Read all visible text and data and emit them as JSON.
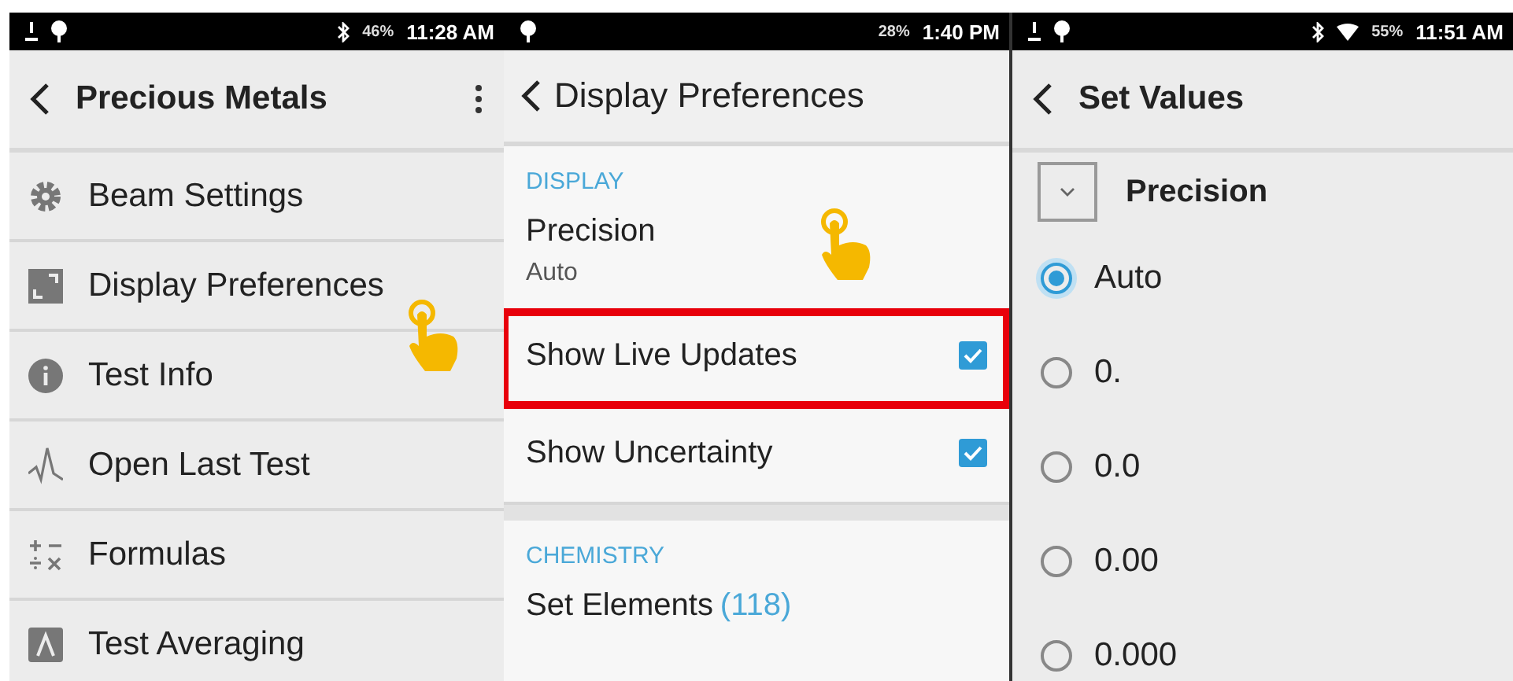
{
  "screens": [
    {
      "kind": "menu",
      "status": {
        "battery": "46%",
        "time": "11:28 AM"
      },
      "title": "Precious Metals",
      "items": [
        {
          "label": "Beam Settings"
        },
        {
          "label": "Display Preferences"
        },
        {
          "label": "Test Info"
        },
        {
          "label": "Open Last Test"
        },
        {
          "label": "Formulas"
        },
        {
          "label": "Test Averaging"
        }
      ]
    },
    {
      "kind": "preferences",
      "status": {
        "battery": "28%",
        "time": "1:40 PM"
      },
      "title": "Display Preferences",
      "sections": [
        {
          "header": "DISPLAY",
          "rows": [
            {
              "kind": "value",
              "label": "Precision",
              "value": "Auto"
            },
            {
              "kind": "checkbox",
              "label": "Show Live Updates",
              "checked": true,
              "highlighted": true
            },
            {
              "kind": "checkbox",
              "label": "Show Uncertainty",
              "checked": true
            }
          ]
        },
        {
          "header": "CHEMISTRY",
          "rows": [
            {
              "kind": "count",
              "label": "Set Elements",
              "count": "(118)"
            }
          ]
        }
      ]
    },
    {
      "kind": "options",
      "status": {
        "battery": "55%",
        "time": "11:51 AM"
      },
      "title": "Set Values",
      "group": {
        "label": "Precision",
        "expanded": true
      },
      "options": [
        {
          "label": "Auto",
          "selected": true
        },
        {
          "label": "0.",
          "selected": false
        },
        {
          "label": "0.0",
          "selected": false
        },
        {
          "label": "0.00",
          "selected": false
        },
        {
          "label": "0.000",
          "selected": false
        }
      ]
    }
  ]
}
